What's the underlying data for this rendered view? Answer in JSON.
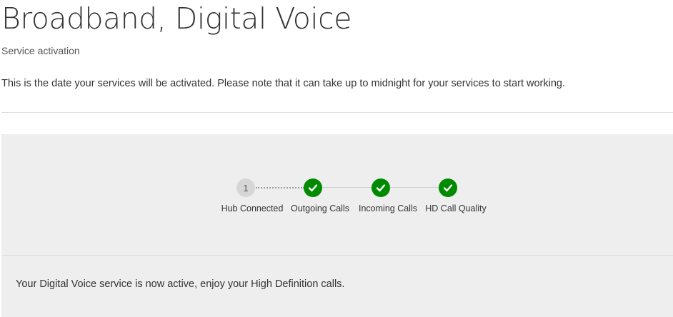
{
  "header": {
    "title": "Broadband, Digital Voice",
    "subtitle": "Service activation",
    "description": "This is the date your services will be activated. Please note that it can take up to midnight for your services to start working."
  },
  "progress": {
    "steps": [
      {
        "label": "Hub Connected",
        "state": "pending",
        "number": "1",
        "icon": "number-badge"
      },
      {
        "label": "Outgoing Calls",
        "state": "complete",
        "icon": "check-icon"
      },
      {
        "label": "Incoming Calls",
        "state": "complete",
        "icon": "check-icon"
      },
      {
        "label": "HD Call Quality",
        "state": "complete",
        "icon": "check-icon"
      }
    ],
    "complete_color": "#008a00",
    "pending_color": "#d6d6d6"
  },
  "status": {
    "message": "Your Digital Voice service is now active, enjoy your High Definition calls."
  }
}
